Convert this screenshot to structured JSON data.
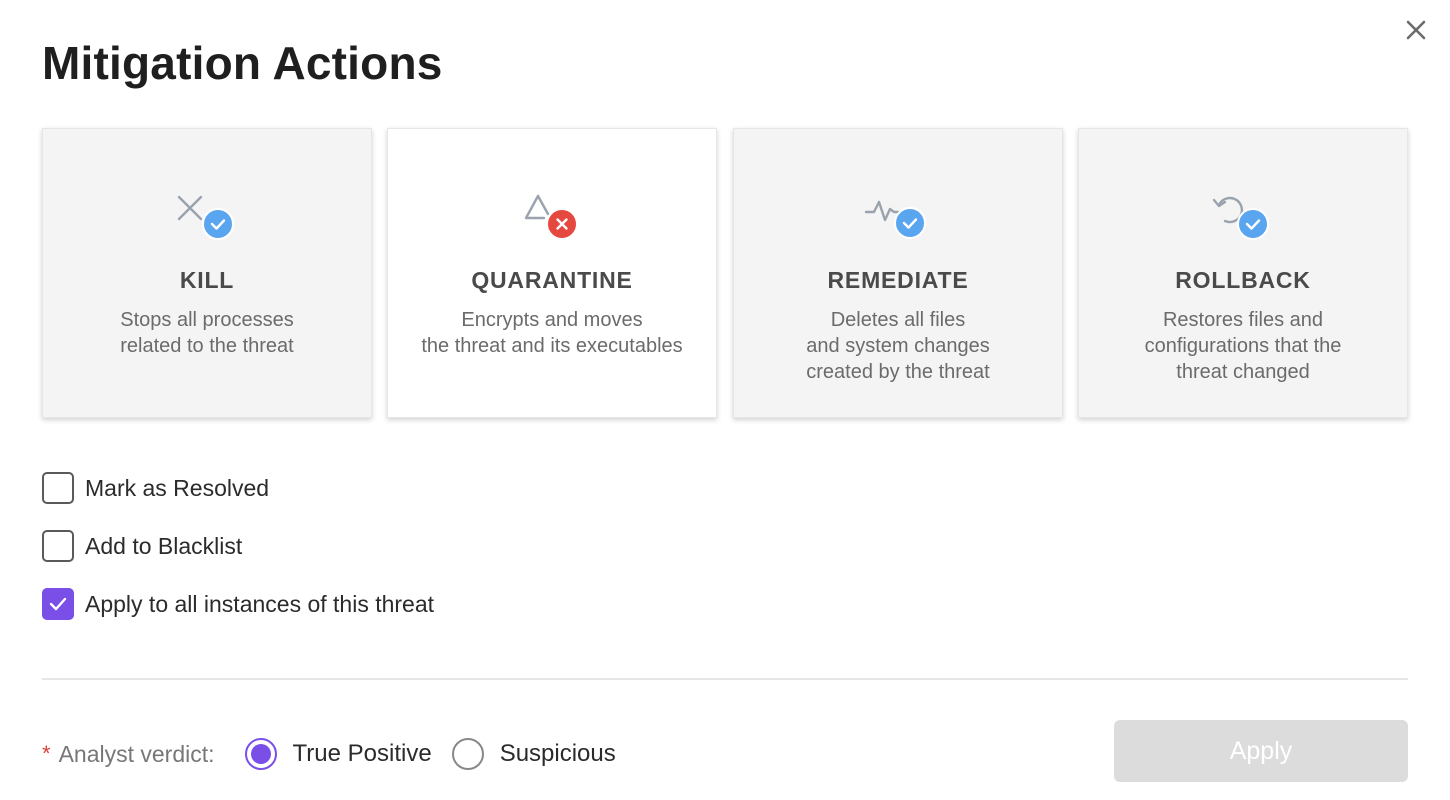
{
  "dialog": {
    "title": "Mitigation Actions",
    "close_icon": "close-icon"
  },
  "actions": [
    {
      "name": "KILL",
      "desc": [
        "Stops all processes",
        "related to the threat"
      ],
      "icon": "kill-x-icon",
      "status": "success",
      "selected": false
    },
    {
      "name": "QUARANTINE",
      "desc": [
        "Encrypts and moves",
        "the threat and its executables"
      ],
      "icon": "quarantine-triangle-icon",
      "status": "failed",
      "selected": true
    },
    {
      "name": "REMEDIATE",
      "desc": [
        "Deletes all files",
        "and system changes",
        "created by the threat"
      ],
      "icon": "remediate-pulse-icon",
      "status": "success",
      "selected": false
    },
    {
      "name": "ROLLBACK",
      "desc": [
        "Restores files and",
        "configurations that the",
        "threat changed"
      ],
      "icon": "rollback-arrow-icon",
      "status": "success",
      "selected": false
    }
  ],
  "options": [
    {
      "label": "Mark as Resolved",
      "checked": false
    },
    {
      "label": "Add to Blacklist",
      "checked": false
    },
    {
      "label": "Apply to all instances of this threat",
      "checked": true
    }
  ],
  "verdict": {
    "required_mark": "*",
    "label": "Analyst verdict:",
    "options": [
      {
        "label": "True Positive",
        "selected": true
      },
      {
        "label": "Suspicious",
        "selected": false
      }
    ]
  },
  "apply_button": {
    "label": "Apply",
    "disabled": true
  },
  "colors": {
    "accent": "#7a4fe8",
    "success_badge": "#5aa5f0",
    "error_badge": "#e5483e",
    "disabled_button": "#dcdcdc"
  }
}
